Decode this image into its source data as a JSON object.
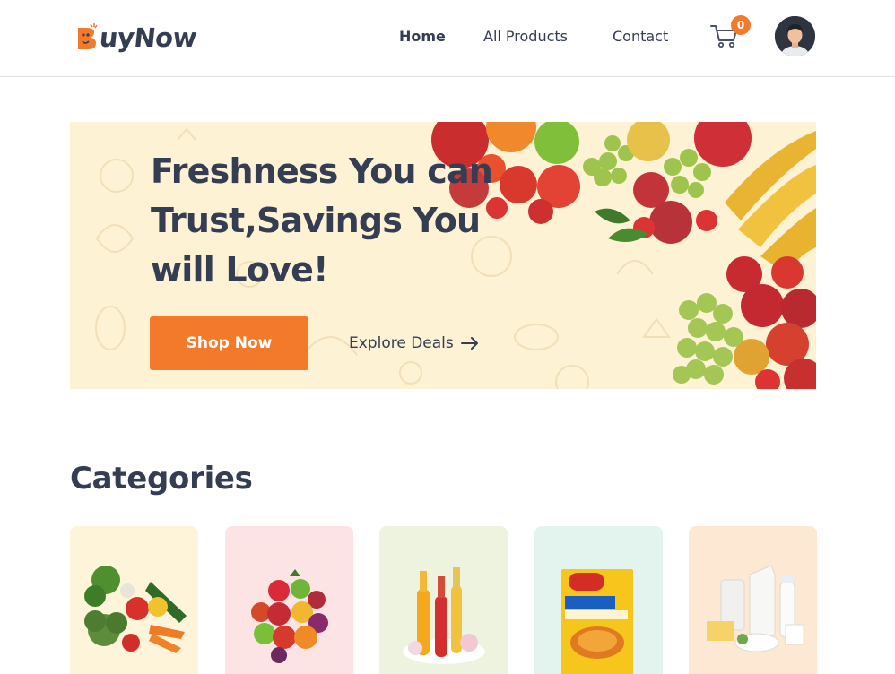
{
  "brand": {
    "logo_initial": "B",
    "logo_rest": "uyNow",
    "accent_color": "#f47a2b",
    "text_color": "#343d52"
  },
  "nav": {
    "items": [
      {
        "label": "Home",
        "active": true
      },
      {
        "label": "All Products",
        "active": false
      },
      {
        "label": "Contact",
        "active": false
      }
    ],
    "cart_icon": "cart-icon",
    "cart_count": "0",
    "avatar_icon": "user-avatar"
  },
  "hero": {
    "title": "Freshness You can Trust,Savings You will Love!",
    "primary_button": "Shop Now",
    "secondary_link": "Explore Deals",
    "secondary_icon": "arrow-right-icon",
    "background_color": "#fdf2d4"
  },
  "categories": {
    "title": "Categories",
    "items": [
      {
        "image": "vegetables-image",
        "bg": "#fdf4d9"
      },
      {
        "image": "fruits-image",
        "bg": "#fde4e4"
      },
      {
        "image": "beverages-image",
        "bg": "#eef3e0"
      },
      {
        "image": "instant-noodles-image",
        "bg": "#e3f3ee"
      },
      {
        "image": "dairy-image",
        "bg": "#fde8d4"
      }
    ]
  }
}
